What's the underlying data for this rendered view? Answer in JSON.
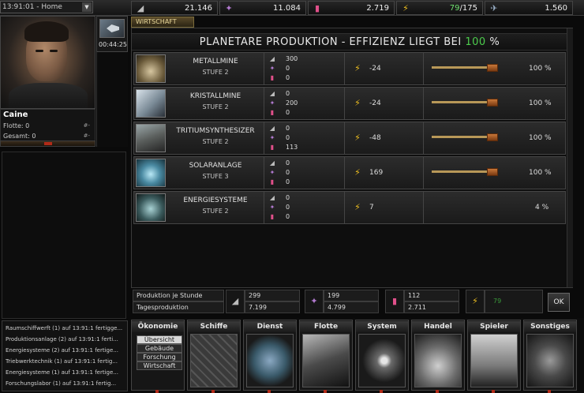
{
  "top": {
    "planet_select": "13:91:01 - Home",
    "resources": [
      {
        "icon": "metal-icon",
        "value": "21.146"
      },
      {
        "icon": "crystal-icon",
        "value": "11.084"
      },
      {
        "icon": "tritium-icon",
        "value": "2.719"
      },
      {
        "icon": "energy-icon",
        "value_used": "79",
        "value_total": "/175"
      },
      {
        "icon": "ship-icon",
        "value": "1.560"
      }
    ]
  },
  "commander": {
    "name": "Caine",
    "flotte_label": "Flotte: 0",
    "gesamt_label": "Gesamt: 0",
    "flotte_rank": "#-",
    "gesamt_rank": "#-"
  },
  "ship_timer": "00:44:25",
  "event_log": [
    "Raumschiffwerft (1) auf 13:91:1 fertigge...",
    "Produktionsanlage (2) auf 13:91:1 ferti...",
    "Energiesysteme (2) auf 13:91:1 fertige...",
    "Triebwerktechnik (1) auf 13:91:1 fertig...",
    "Energiesysteme (1) auf 13:91:1 fertige...",
    "Forschungslabor (1) auf 13:91:1 fertig..."
  ],
  "main": {
    "tab": "WIRTSCHAFT",
    "header_text": "PLANETARE PRODUKTION - EFFIZIENZ LIEGT BEI",
    "efficiency": "100",
    "efficiency_unit": "%",
    "buildings": [
      {
        "name": "METALLMINE",
        "level": "STUFE 2",
        "metal": "300",
        "crystal": "0",
        "tritium": "0",
        "energy": "-24",
        "percent": "100 %",
        "production_level": 1.0
      },
      {
        "name": "KRISTALLMINE",
        "level": "STUFE 2",
        "metal": "0",
        "crystal": "200",
        "tritium": "0",
        "energy": "-24",
        "percent": "100 %",
        "production_level": 1.0
      },
      {
        "name": "TRITIUMSYNTHESIZER",
        "level": "STUFE 2",
        "metal": "0",
        "crystal": "0",
        "tritium": "113",
        "energy": "-48",
        "percent": "100 %",
        "production_level": 1.0
      },
      {
        "name": "SOLARANLAGE",
        "level": "STUFE 3",
        "metal": "0",
        "crystal": "0",
        "tritium": "0",
        "energy": "169",
        "percent": "100 %",
        "production_level": 1.0
      },
      {
        "name": "ENERGIESYSTEME",
        "level": "STUFE 2",
        "metal": "0",
        "crystal": "0",
        "tritium": "0",
        "energy": "7",
        "percent": "4 %",
        "production_level": null
      }
    ],
    "totals": {
      "per_hour_label": "Produktion je Stunde",
      "per_day_label": "Tagesproduktion",
      "metal_hour": "299",
      "metal_day": "7.199",
      "crystal_hour": "199",
      "crystal_day": "4.799",
      "tritium_hour": "112",
      "tritium_day": "2.711",
      "energy": "79",
      "ok_label": "OK"
    }
  },
  "nav": {
    "tabs": [
      "Ökonomie",
      "Schiffe",
      "Dienst",
      "Flotte",
      "System",
      "Handel",
      "Spieler",
      "Sonstiges"
    ],
    "okonomie_sub": [
      "Übersicht",
      "Gebäude",
      "Forschung",
      "Wirtschaft"
    ]
  },
  "colors": {
    "accent_green": "#4ccc4c",
    "slider": "#c8783a",
    "energy_yellow": "#f0c020"
  }
}
